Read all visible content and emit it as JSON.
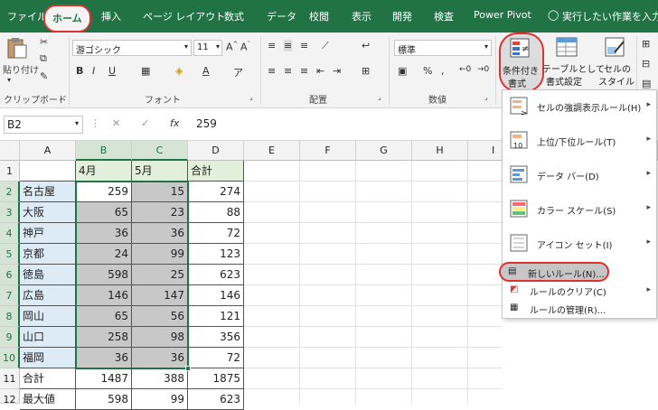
{
  "tabs": [
    "ファイル",
    "ホーム",
    "挿入",
    "ページ レイアウト",
    "数式",
    "データ",
    "校閲",
    "表示",
    "開発",
    "検査",
    "Power Pivot"
  ],
  "tell_me": "実行したい作業を入力し",
  "ribbon": {
    "paste_label": "貼り付け",
    "clipboard_label": "クリップボード",
    "font_name": "游ゴシック",
    "font_size": "11",
    "font_group_label": "フォント",
    "align_group_label": "配置",
    "number_format": "標準",
    "number_group_label": "数値",
    "cond_format_line1": "条件付き",
    "cond_format_line2": "書式",
    "table_format_line1": "テーブルとして",
    "table_format_line2": "書式設定",
    "cell_style_line1": "セルの",
    "cell_style_line2": "スタイル",
    "bold": "B",
    "italic": "I",
    "underline": "U",
    "font_color": "A",
    "percent": "%",
    "comma": ","
  },
  "formula_bar": {
    "name_box": "B2",
    "fx": "fx",
    "value": "259"
  },
  "columns": [
    "A",
    "B",
    "C",
    "D",
    "E",
    "F",
    "G",
    "H",
    "I"
  ],
  "rows": [
    {
      "n": "1",
      "a": "",
      "b": "4月",
      "c": "5月",
      "d": "合計"
    },
    {
      "n": "2",
      "a": "名古屋",
      "b": "259",
      "c": "15",
      "d": "274"
    },
    {
      "n": "3",
      "a": "大阪",
      "b": "65",
      "c": "23",
      "d": "88"
    },
    {
      "n": "4",
      "a": "神戸",
      "b": "36",
      "c": "36",
      "d": "72"
    },
    {
      "n": "5",
      "a": "京都",
      "b": "24",
      "c": "99",
      "d": "123"
    },
    {
      "n": "6",
      "a": "徳島",
      "b": "598",
      "c": "25",
      "d": "623"
    },
    {
      "n": "7",
      "a": "広島",
      "b": "146",
      "c": "147",
      "d": "146"
    },
    {
      "n": "8",
      "a": "岡山",
      "b": "65",
      "c": "56",
      "d": "121"
    },
    {
      "n": "9",
      "a": "山口",
      "b": "258",
      "c": "98",
      "d": "356"
    },
    {
      "n": "10",
      "a": "福岡",
      "b": "36",
      "c": "36",
      "d": "72"
    },
    {
      "n": "11",
      "a": "合計",
      "b": "1487",
      "c": "388",
      "d": "1875"
    },
    {
      "n": "12",
      "a": "最大値",
      "b": "598",
      "c": "99",
      "d": "623"
    }
  ],
  "menu": {
    "highlight_rules": "セルの強調表示ルール(H)",
    "topbottom_rules": "上位/下位ルール(T)",
    "data_bars": "データ バー(D)",
    "color_scales": "カラー スケール(S)",
    "icon_sets": "アイコン セット(I)",
    "new_rule": "新しいルール(N)...",
    "clear_rules": "ルールのクリア(C)",
    "manage_rules": "ルールの管理(R)..."
  },
  "colors": {
    "accent": "#217346",
    "highlight": "#e03030"
  }
}
